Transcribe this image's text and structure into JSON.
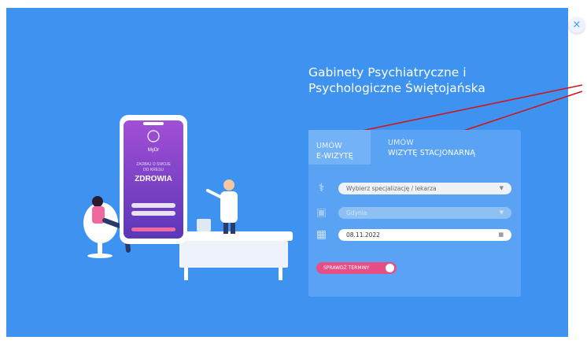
{
  "header": {
    "title_line1": "Gabinety Psychiatryczne i",
    "title_line2": "Psychologiczne Świętojańska"
  },
  "tabs": [
    {
      "line1": "UMÓW",
      "line2": "E-WIZYTĘ",
      "active": true
    },
    {
      "line1": "UMÓW",
      "line2": "WIZYTĘ STACJONARNĄ",
      "active": false
    }
  ],
  "form": {
    "specialization": "Wybierz specjalizację / lekarza",
    "city": "Gdynia",
    "date": "08.11.2022",
    "search_label": "SPRAWDŹ TERMINY"
  },
  "phone": {
    "logo": "MyDr",
    "tagline_line1": "ZADBAJ O SWOJE",
    "tagline_line2": "DO KRESU",
    "tagline_big": "ZDROWIA"
  },
  "close_label": "×",
  "colors": {
    "background": "#3f93f0",
    "panel": "#5aa3f4",
    "accent": "#e64f86",
    "annotation": "#d0161b"
  },
  "icons": {
    "close": "close-icon",
    "doctor": "stethoscope-icon",
    "location": "building-icon",
    "date": "calendar-icon"
  }
}
